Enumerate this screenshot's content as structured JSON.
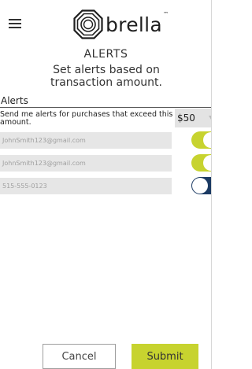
{
  "header": {
    "menu_icon": "hamburger-menu-icon",
    "logo_icon": "umbrella-octagon-icon",
    "logo_text": "brella",
    "logo_mark": "™"
  },
  "page": {
    "title": "ALERTS",
    "subtitle": "Set alerts based on transaction amount."
  },
  "alerts": {
    "section_label": "Alerts",
    "threshold_text": "Send me alerts for purchases that exceed this amount.",
    "threshold_value": "$50",
    "dropdown_icon": "chevron-down-icon",
    "contacts": [
      {
        "placeholder": "JohnSmith123@gmail.com",
        "enabled": true
      },
      {
        "placeholder": "JohnSmith123@gmail.com",
        "enabled": true
      },
      {
        "placeholder": "515-555-0123",
        "enabled": false
      }
    ]
  },
  "colors": {
    "accent": "#c7d32f",
    "toggle_off": "#1b3a63",
    "field_bg": "#e6e6e6"
  },
  "footer": {
    "cancel_label": "Cancel",
    "submit_label": "Submit"
  }
}
